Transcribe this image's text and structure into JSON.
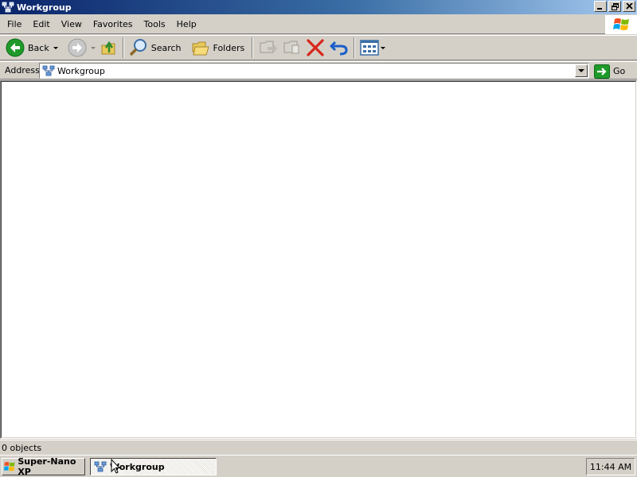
{
  "window": {
    "title": "Workgroup"
  },
  "menu": [
    "File",
    "Edit",
    "View",
    "Favorites",
    "Tools",
    "Help"
  ],
  "toolbar": {
    "back_label": "Back",
    "search_label": "Search",
    "folders_label": "Folders"
  },
  "address": {
    "label": "Address",
    "value": "Workgroup",
    "go_label": "Go"
  },
  "status": {
    "text": "0 objects"
  },
  "taskbar": {
    "start_label": "Super-Nano XP",
    "task_label": "Workgroup",
    "clock": "11:44 AM"
  },
  "colors": {
    "title_gradient_start": "#0a246a",
    "title_gradient_end": "#a6caf0",
    "face": "#d4d0c8",
    "back_green": "#1e9a2a",
    "delete_red": "#d8261b",
    "undo_blue": "#1b5fc8"
  },
  "icons": {
    "title": "network-workgroup-icon",
    "back": "back-arrow-icon",
    "forward": "forward-arrow-icon",
    "up": "folder-up-icon",
    "search": "magnifier-icon",
    "folders": "folders-icon",
    "move_to": "move-to-icon",
    "copy_to": "copy-to-icon",
    "delete": "delete-x-icon",
    "undo": "undo-icon",
    "views": "views-icon",
    "go": "go-arrow-icon",
    "windows_logo": "windows-logo-icon"
  }
}
